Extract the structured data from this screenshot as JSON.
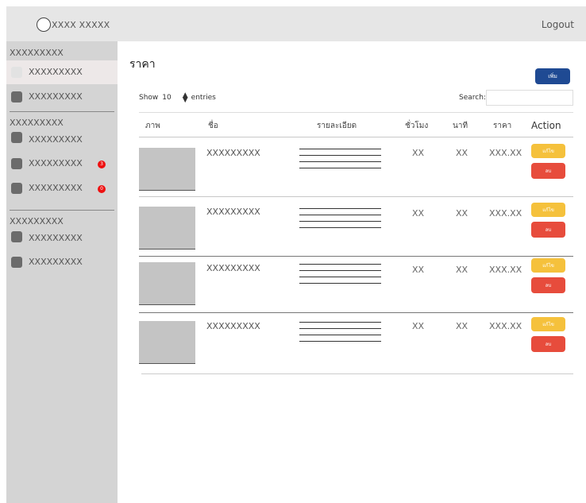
{
  "header": {
    "brand": "XXXX XXXXX",
    "logout": "Logout"
  },
  "sidebar": {
    "sections": [
      "XXXXXXXXX",
      "XXXXXXXXX",
      "XXXXXXXXX"
    ],
    "items": [
      {
        "label": "XXXXXXXXX"
      },
      {
        "label": "XXXXXXXXX"
      },
      {
        "label": "XXXXXXXXX"
      },
      {
        "label": "XXXXXXXXX",
        "badge": "3"
      },
      {
        "label": "XXXXXXXXX",
        "badge": "0"
      },
      {
        "label": "XXXXXXXXX"
      },
      {
        "label": "XXXXXXXXX"
      }
    ]
  },
  "page": {
    "title": "ราคา",
    "add_label": "เพิ่ม"
  },
  "controls": {
    "show": "Show",
    "entries_value": "10",
    "entries": "entries",
    "search_label": "Search:",
    "search_value": ""
  },
  "table": {
    "columns": [
      "ภาพ",
      "ชื่อ",
      "รายละเอียด",
      "ชั่วโมง",
      "นาที",
      "ราคา",
      "Action"
    ],
    "rows": [
      {
        "name": "XXXXXXXXX",
        "hours": "XX",
        "minutes": "XX",
        "price": "XXX.XX",
        "edit": "แก้ไข",
        "delete": "ลบ"
      },
      {
        "name": "XXXXXXXXX",
        "hours": "XX",
        "minutes": "XX",
        "price": "XXX.XX",
        "edit": "แก้ไข",
        "delete": "ลบ"
      },
      {
        "name": "XXXXXXXXX",
        "hours": "XX",
        "minutes": "XX",
        "price": "XXX.XX",
        "edit": "แก้ไข",
        "delete": "ลบ"
      },
      {
        "name": "XXXXXXXXX",
        "hours": "XX",
        "minutes": "XX",
        "price": "XXX.XX",
        "edit": "แก้ไข",
        "delete": "ลบ"
      }
    ]
  },
  "colors": {
    "add": "#1f4a93",
    "edit": "#f5c13c",
    "delete": "#e74c3c",
    "badge": "#ee1111"
  }
}
